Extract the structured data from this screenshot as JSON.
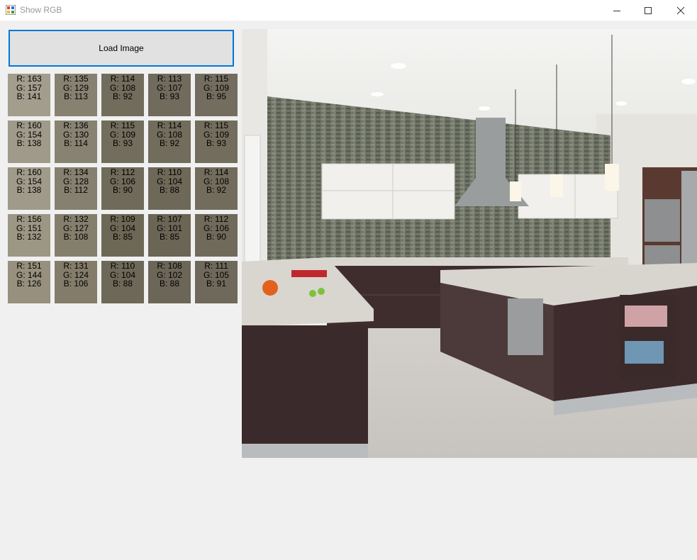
{
  "window": {
    "title": "Show RGB",
    "icon": "app-icon"
  },
  "toolbar": {
    "load_label": "Load Image"
  },
  "swatch_grid": {
    "rows": [
      [
        {
          "r": "R: 163",
          "g": "G: 157",
          "b": "B: 141",
          "color": "#a39d8d"
        },
        {
          "r": "R: 135",
          "g": "G: 129",
          "b": "B: 113",
          "color": "#878171"
        },
        {
          "r": "R: 114",
          "g": "G: 108",
          "b": "B: 92",
          "color": "#726c5c"
        },
        {
          "r": "R: 113",
          "g": "G: 107",
          "b": "B: 93",
          "color": "#716b5d"
        },
        {
          "r": "R: 115",
          "g": "G: 109",
          "b": "B: 95",
          "color": "#736d5f"
        }
      ],
      [
        {
          "r": "R: 160",
          "g": "G: 154",
          "b": "B: 138",
          "color": "#a09a8a"
        },
        {
          "r": "R: 136",
          "g": "G: 130",
          "b": "B: 114",
          "color": "#888272"
        },
        {
          "r": "R: 115",
          "g": "G: 109",
          "b": "B: 93",
          "color": "#736d5d"
        },
        {
          "r": "R: 114",
          "g": "G: 108",
          "b": "B: 92",
          "color": "#726c5c"
        },
        {
          "r": "R: 115",
          "g": "G: 109",
          "b": "B: 93",
          "color": "#736d5d"
        }
      ],
      [
        {
          "r": "R: 160",
          "g": "G: 154",
          "b": "B: 138",
          "color": "#a09a8a"
        },
        {
          "r": "R: 134",
          "g": "G: 128",
          "b": "B: 112",
          "color": "#868070"
        },
        {
          "r": "R: 112",
          "g": "G: 106",
          "b": "B: 90",
          "color": "#706a5a"
        },
        {
          "r": "R: 110",
          "g": "G: 104",
          "b": "B: 88",
          "color": "#6e6858"
        },
        {
          "r": "R: 114",
          "g": "G: 108",
          "b": "B: 92",
          "color": "#726c5c"
        }
      ],
      [
        {
          "r": "R: 156",
          "g": "G: 151",
          "b": "B: 132",
          "color": "#9c9784"
        },
        {
          "r": "R: 132",
          "g": "G: 127",
          "b": "B: 108",
          "color": "#847f6c"
        },
        {
          "r": "R: 109",
          "g": "G: 104",
          "b": "B: 85",
          "color": "#6d6855"
        },
        {
          "r": "R: 107",
          "g": "G: 101",
          "b": "B: 85",
          "color": "#6b6555"
        },
        {
          "r": "R: 112",
          "g": "G: 106",
          "b": "B: 90",
          "color": "#706a5a"
        }
      ],
      [
        {
          "r": "R: 151",
          "g": "G: 144",
          "b": "B: 126",
          "color": "#97907e"
        },
        {
          "r": "R: 131",
          "g": "G: 124",
          "b": "B: 106",
          "color": "#837c6a"
        },
        {
          "r": "R: 110",
          "g": "G: 104",
          "b": "B: 88",
          "color": "#6e6858"
        },
        {
          "r": "R: 108",
          "g": "G: 102",
          "b": "B: 88",
          "color": "#6c6658"
        },
        {
          "r": "R: 111",
          "g": "G: 105",
          "b": "B: 91",
          "color": "#6f695b"
        }
      ]
    ]
  },
  "preview": {
    "subject": "kitchen-photo"
  },
  "colors": {
    "accent": "#0078d7",
    "background": "#f0f0f0",
    "button": "#e1e1e1"
  }
}
